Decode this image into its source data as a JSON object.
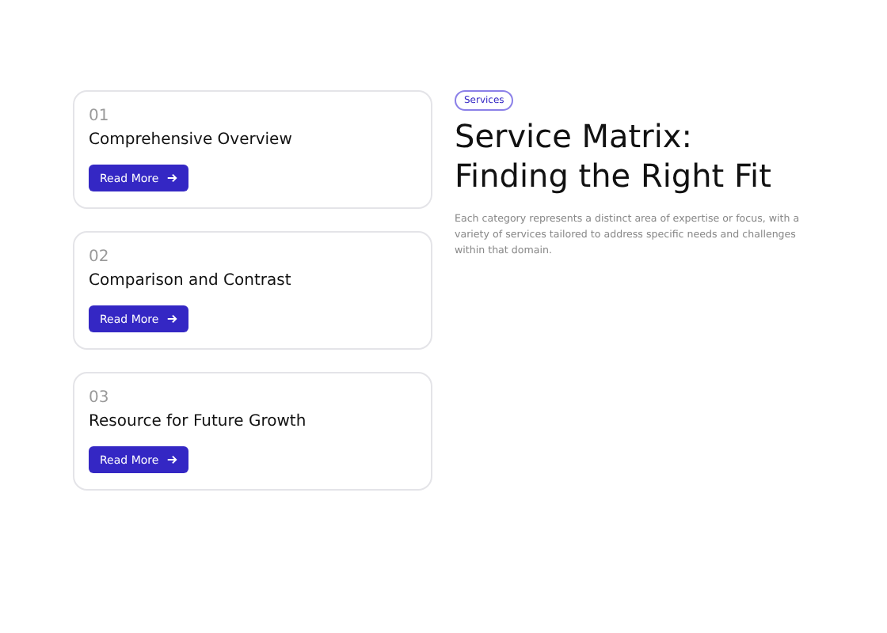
{
  "cards": [
    {
      "number": "01",
      "title": "Comprehensive Overview",
      "button": "Read More"
    },
    {
      "number": "02",
      "title": "Comparison and Contrast",
      "button": "Read More"
    },
    {
      "number": "03",
      "title": "Resource for Future Growth",
      "button": "Read More"
    }
  ],
  "badge": "Services",
  "heading": "Service Matrix: Finding the Right Fit",
  "description": "Each category represents a distinct area of expertise or focus, with a variety of services tailored to address specific needs and challenges within that domain."
}
